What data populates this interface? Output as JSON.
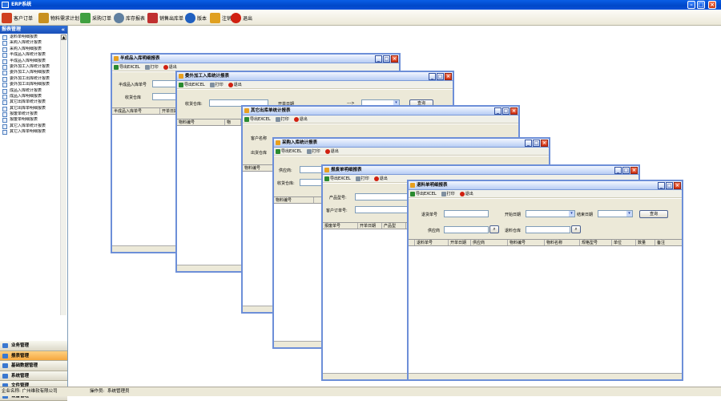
{
  "app": {
    "title": "ERP系统"
  },
  "toolbar": [
    {
      "label": "客户订单",
      "icon": "customer-order-icon",
      "color": "#d04020"
    },
    {
      "label": "物料需求计划",
      "icon": "material-plan-icon",
      "color": "#c89020"
    },
    {
      "label": "采购订单",
      "icon": "purchase-order-icon",
      "color": "#40a040"
    },
    {
      "label": "库存报表",
      "icon": "magnifier-icon",
      "color": "#6080a0"
    },
    {
      "label": "销售出库单",
      "icon": "sales-delivery-icon",
      "color": "#c03030"
    },
    {
      "label": "版本",
      "icon": "info-icon",
      "color": "#2060c0"
    },
    {
      "label": "注销",
      "icon": "logout-icon",
      "color": "#e0a020"
    },
    {
      "label": "退出",
      "icon": "exit-icon",
      "color": "#d02010"
    }
  ],
  "sidebar": {
    "title": "报表管理",
    "items": [
      "退料单明细报表",
      "采购入库统计报表",
      "采购入库明细报表",
      "半成品入库统计报表",
      "半成品入库明细报表",
      "委外加工入库统计报表",
      "委外加工入库明细报表",
      "委外加工出库统计报表",
      "委外加工出库明细报表",
      "成品入库统计报表",
      "成品入库明细报表",
      "其它出库单统计报表",
      "其它出库单明细报表",
      "报废单统计报表",
      "报废单明细报表",
      "其它入库单统计报表",
      "其它入库单明细报表"
    ],
    "nav": [
      "业务管理",
      "报表管理",
      "基础数据管理",
      "系统管理",
      "文件管理",
      "设备管理"
    ],
    "active_nav": 1
  },
  "status": {
    "company": "企业名称: 广州维软有限公司",
    "operator": "操作员:",
    "operator_name": "系统管理员"
  },
  "common": {
    "export": "导出EXCEL",
    "print": "打印",
    "exit": "退出"
  },
  "windows": {
    "w1": {
      "title": "半成品入库明细报表",
      "f1": "半成品入库单号",
      "f2": "收货仓库",
      "cols": [
        "半成品入库单号",
        "开单日期"
      ]
    },
    "w2": {
      "title": "委外加工入库统计报表",
      "f1": "收货仓库:",
      "date_label": "开单日期",
      "arrow": "--->",
      "query": "查询",
      "cols": [
        "物料编号",
        "物"
      ]
    },
    "w3": {
      "title": "其它出库单统计报表",
      "f1": "客户名称",
      "f2": "出货仓库",
      "cols": [
        "物料编号"
      ]
    },
    "w4": {
      "title": "采购入库统计报表",
      "f1": "供应商:",
      "f2": "收货仓库:",
      "cols": [
        "物料编号"
      ]
    },
    "w5": {
      "title": "报废单明细报表",
      "f1": "产品型号:",
      "f2": "客户订单号:",
      "cols": [
        "报废单号",
        "开单日期",
        "产品型"
      ]
    },
    "w6": {
      "title": "退料单明细报表",
      "return_no": "退货单号",
      "start_date": "开始日期",
      "end_date": "结束日期",
      "supplier": "供应商",
      "warehouse": "退料仓库",
      "query": "查询",
      "cols": [
        "退料单号",
        "开单日期",
        "供应商",
        "物料编号",
        "物料名称",
        "规格型号",
        "单位",
        "数量",
        "备注"
      ]
    }
  }
}
